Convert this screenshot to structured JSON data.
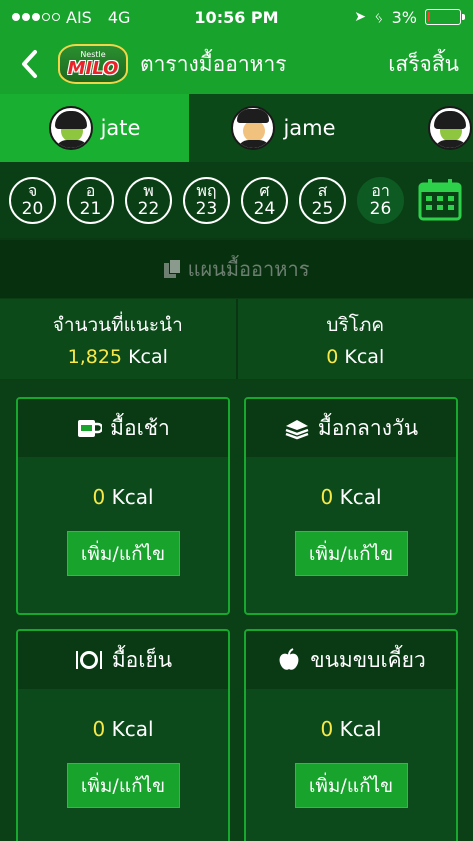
{
  "status_bar": {
    "carrier": "AIS",
    "network": "4G",
    "time": "10:56 PM",
    "battery": "3%",
    "battery_level": 0.03,
    "colors": {
      "battery_low": "#ff3b30"
    }
  },
  "nav": {
    "back_icon": "chevron-left-icon",
    "logo_brand": "Nestle",
    "logo_name": "MILO",
    "title": "ตารางมื้ออาหาร",
    "done_label": "เสร็จสิ้น"
  },
  "profiles": [
    {
      "name": "jate",
      "active": true
    },
    {
      "name": "jame",
      "active": false
    },
    {
      "name": "",
      "active": false
    }
  ],
  "days": [
    {
      "abbr": "จ",
      "num": "20",
      "active": false
    },
    {
      "abbr": "อ",
      "num": "21",
      "active": false
    },
    {
      "abbr": "พ",
      "num": "22",
      "active": false
    },
    {
      "abbr": "พฤ",
      "num": "23",
      "active": false
    },
    {
      "abbr": "ศ",
      "num": "24",
      "active": false
    },
    {
      "abbr": "ส",
      "num": "25",
      "active": false
    },
    {
      "abbr": "อา",
      "num": "26",
      "active": true
    }
  ],
  "plan": {
    "label": "แผนมื้ออาหาร",
    "icon": "copy-icon"
  },
  "summary": {
    "recommended_label": "จำนวนที่แนะนำ",
    "recommended_value": "1,825",
    "consumed_label": "บริโภค",
    "consumed_value": "0",
    "unit": "Kcal"
  },
  "meals": [
    {
      "name": "มื้อเช้า",
      "icon": "coffee-mug-icon",
      "kcal": "0",
      "unit": "Kcal",
      "button": "เพิ่ม/แก้ไข"
    },
    {
      "name": "มื้อกลางวัน",
      "icon": "sandwich-icon",
      "kcal": "0",
      "unit": "Kcal",
      "button": "เพิ่ม/แก้ไข"
    },
    {
      "name": "มื้อเย็น",
      "icon": "plate-cutlery-icon",
      "kcal": "0",
      "unit": "Kcal",
      "button": "เพิ่ม/แก้ไข"
    },
    {
      "name": "ขนมขบเคี้ยว",
      "icon": "apple-icon",
      "kcal": "0",
      "unit": "Kcal",
      "button": "เพิ่ม/แก้ไข"
    }
  ],
  "colors": {
    "primary_green": "#17a32c",
    "dark_green": "#0b3f15",
    "highlight_yellow": "#f7e94a"
  }
}
